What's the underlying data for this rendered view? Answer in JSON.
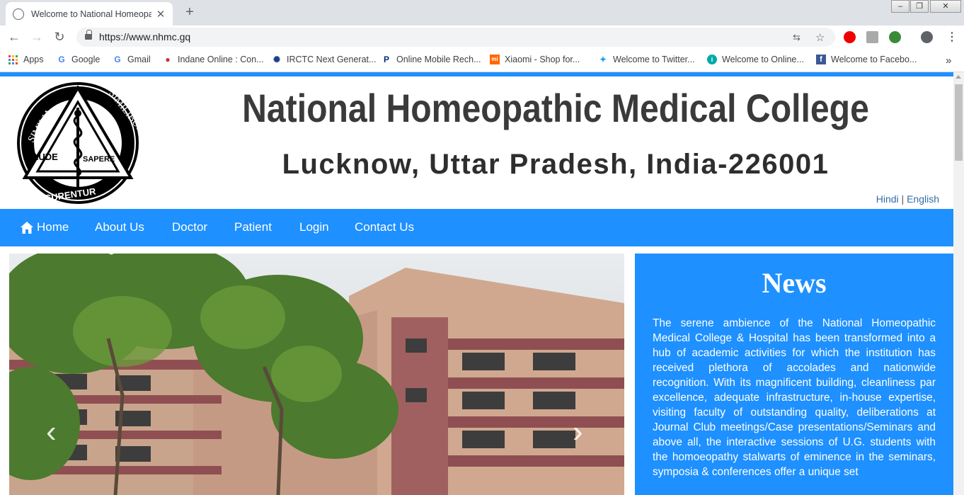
{
  "browser": {
    "tab_title": "Welcome to National Homeopat",
    "url": "https://www.nhmc.gq",
    "bookmarks": [
      {
        "label": "Apps"
      },
      {
        "label": "Google"
      },
      {
        "label": "Gmail"
      },
      {
        "label": "Indane Online : Con..."
      },
      {
        "label": "IRCTC Next Generat..."
      },
      {
        "label": "Online Mobile Rech..."
      },
      {
        "label": "Xiaomi - Shop for..."
      },
      {
        "label": "Welcome to Twitter..."
      },
      {
        "label": "Welcome to Online..."
      },
      {
        "label": "Welcome to Facebo..."
      }
    ],
    "overflow_label": "»"
  },
  "header": {
    "title": "National Homeopathic Medical College",
    "subtitle": "Lucknow, Uttar Pradesh, India-226001",
    "logo_text": {
      "top_left": "SIMILIA",
      "top_right": "SIMILIBUS",
      "middle_left": "AUDE",
      "middle_right": "SAPERE",
      "bottom": "CURENTUR"
    },
    "lang_hindi": "Hindi",
    "lang_separator": "|",
    "lang_english": "English"
  },
  "nav": {
    "items": [
      {
        "label": "Home"
      },
      {
        "label": "About Us"
      },
      {
        "label": "Doctor"
      },
      {
        "label": "Patient"
      },
      {
        "label": "Login"
      },
      {
        "label": "Contact Us"
      }
    ]
  },
  "carousel": {
    "prev_label": "‹",
    "next_label": "›"
  },
  "news": {
    "heading": "News",
    "body": "The serene ambience of the National Homeopathic Medical College & Hospital has been transformed into a hub of academic activities for which the institution has received plethora of accolades and nationwide recognition. With its magnificent building, cleanliness par excellence, adequate infrastructure, in-house expertise, visiting faculty of outstanding quality, deliberations at Journal Club meetings/Case presentations/Seminars and above all, the interactive sessions of U.G. students with the homoeopathy stalwarts of eminence in the seminars, symposia & conferences offer a unique set"
  },
  "colors": {
    "brand_blue": "#1e90ff",
    "title_gray": "#3a3a3a"
  }
}
